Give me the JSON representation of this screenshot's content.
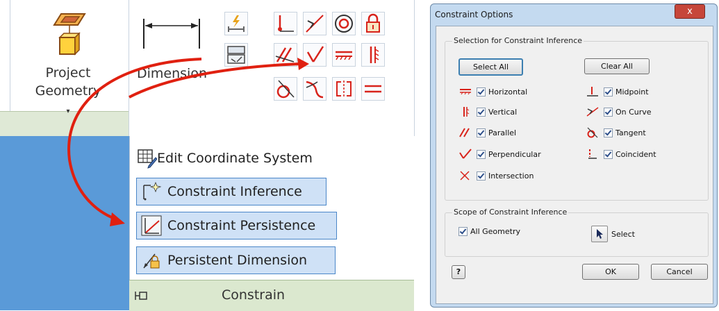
{
  "ribbon": {
    "project_geometry": {
      "line1": "Project",
      "line2": "Geometry"
    },
    "dimension_label": "Dimension"
  },
  "menu": {
    "edit_coord": "Edit Coordinate System",
    "constraint_inference": "Constraint Inference",
    "constraint_persistence": "Constraint Persistence",
    "persistent_dimension": "Persistent Dimension",
    "footer": "Constrain"
  },
  "dialog": {
    "title": "Constraint Options",
    "close": "x",
    "selection_group": "Selection for Constraint Inference",
    "select_all": "Select All",
    "clear_all": "Clear All",
    "left_items": [
      "Horizontal",
      "Vertical",
      "Parallel",
      "Perpendicular",
      "Intersection"
    ],
    "right_items": [
      "Midpoint",
      "On Curve",
      "Tangent",
      "Coincident"
    ],
    "scope_group": "Scope of Constraint Inference",
    "all_geometry": "All Geometry",
    "select": "Select",
    "ok": "OK",
    "cancel": "Cancel",
    "help": "?"
  },
  "colors": {
    "accent_blue": "#5a9ad8",
    "arrow_red": "#e02010",
    "constraint_red": "#d8231b"
  }
}
